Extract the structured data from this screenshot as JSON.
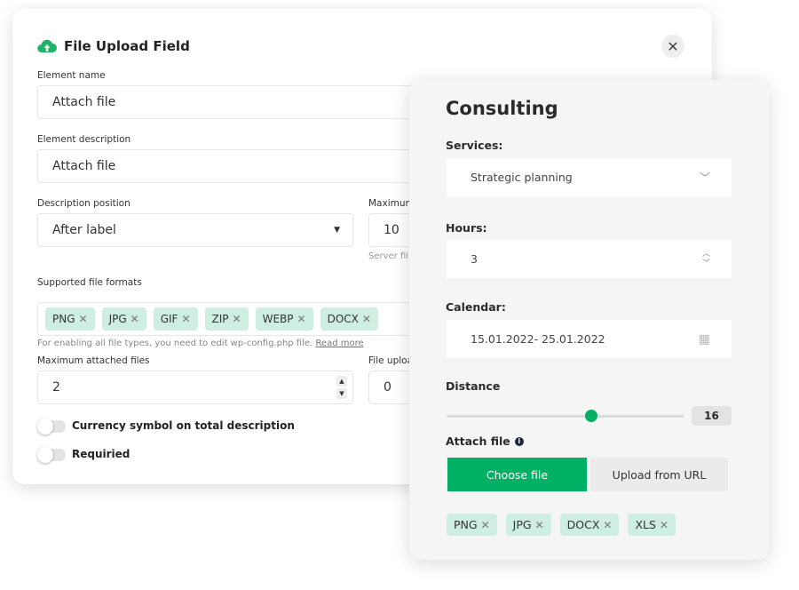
{
  "settings": {
    "title": "File Upload Field",
    "close_icon": "close-icon",
    "element_name_label": "Element name",
    "element_name_value": "Attach file",
    "element_description_label": "Element description",
    "element_description_value": "Attach file",
    "description_position_label": "Description position",
    "description_position_value": "After label",
    "maximum_label": "Maximun",
    "maximum_value": "10",
    "server_hint": "Server fil",
    "formats_label": "Supported file formats",
    "formats": [
      "PNG",
      "JPG",
      "GIF",
      "ZIP",
      "WEBP",
      "DOCX"
    ],
    "formats_hint": "For enabling all file types, you need to edit wp-config.php file.",
    "read_more": "Read more",
    "max_files_label": "Maximum attached files",
    "max_files_value": "2",
    "file_upload_label": "File uploa",
    "file_upload_value": "0",
    "toggle_currency": "Currency symbol on total description",
    "toggle_required": "Requiried",
    "accent": "#1fb46a"
  },
  "form": {
    "title": "Consulting",
    "services_label": "Services:",
    "services_value": "Strategic planning",
    "hours_label": "Hours:",
    "hours_value": "3",
    "calendar_label": "Calendar:",
    "calendar_value": "15.01.2022- 25.01.2022",
    "distance_label": "Distance",
    "distance_value": "16",
    "distance_fraction": 0.61,
    "attach_label": "Attach file",
    "choose_file": "Choose file",
    "upload_url": "Upload from URL",
    "formats": [
      "PNG",
      "JPG",
      "DOCX",
      "XLS"
    ],
    "accent": "#00b064"
  }
}
